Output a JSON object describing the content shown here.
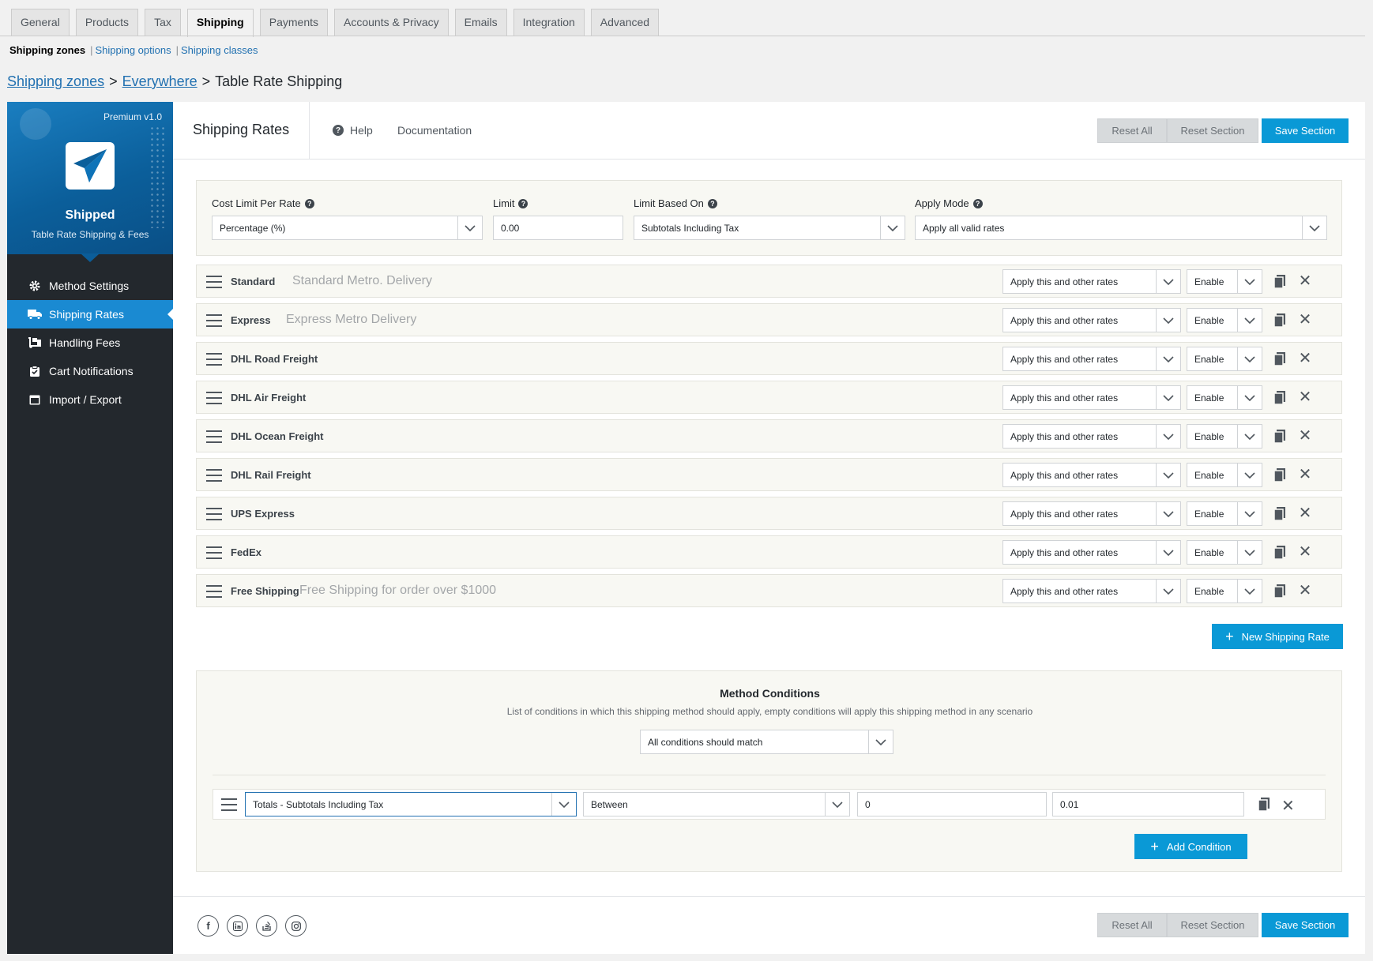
{
  "tabs": [
    "General",
    "Products",
    "Tax",
    "Shipping",
    "Payments",
    "Accounts & Privacy",
    "Emails",
    "Integration",
    "Advanced"
  ],
  "active_tab": "Shipping",
  "subnav": {
    "current": "Shipping zones",
    "links": [
      "Shipping options",
      "Shipping classes"
    ],
    "separator": "|"
  },
  "breadcrumb": {
    "links": [
      "Shipping zones",
      "Everywhere"
    ],
    "current": "Table Rate Shipping",
    "separator": ">"
  },
  "brand": {
    "version": "Premium v1.0",
    "name": "Shipped",
    "tagline": "Table Rate Shipping & Fees"
  },
  "menu": [
    {
      "label": "Method Settings",
      "icon": "gear-icon"
    },
    {
      "label": "Shipping Rates",
      "icon": "truck-icon"
    },
    {
      "label": "Handling Fees",
      "icon": "dolly-icon"
    },
    {
      "label": "Cart Notifications",
      "icon": "clipboard-icon"
    },
    {
      "label": "Import / Export",
      "icon": "window-icon"
    }
  ],
  "active_menu": "Shipping Rates",
  "header": {
    "title": "Shipping Rates",
    "help": "Help",
    "documentation": "Documentation",
    "reset_all": "Reset All",
    "reset_section": "Reset Section",
    "save_section": "Save Section"
  },
  "config": {
    "cost_limit_label": "Cost Limit Per Rate",
    "cost_limit_value": "Percentage (%)",
    "limit_label": "Limit",
    "limit_value": "0.00",
    "limit_based_label": "Limit Based On",
    "limit_based_value": "Subtotals Including Tax",
    "apply_mode_label": "Apply Mode",
    "apply_mode_value": "Apply all valid rates"
  },
  "rates": [
    {
      "name": "Standard",
      "desc": "Standard Metro. Delivery",
      "mode": "Apply this and other rates",
      "status": "Enable"
    },
    {
      "name": "Express",
      "desc": "Express Metro Delivery",
      "mode": "Apply this and other rates",
      "status": "Enable"
    },
    {
      "name": "DHL Road Freight",
      "desc": "",
      "mode": "Apply this and other rates",
      "status": "Enable"
    },
    {
      "name": "DHL Air Freight",
      "desc": "",
      "mode": "Apply this and other rates",
      "status": "Enable"
    },
    {
      "name": "DHL Ocean Freight",
      "desc": "",
      "mode": "Apply this and other rates",
      "status": "Enable"
    },
    {
      "name": "DHL Rail Freight",
      "desc": "",
      "mode": "Apply this and other rates",
      "status": "Enable"
    },
    {
      "name": "UPS Express",
      "desc": "",
      "mode": "Apply this and other rates",
      "status": "Enable"
    },
    {
      "name": "FedEx",
      "desc": "",
      "mode": "Apply this and other rates",
      "status": "Enable"
    },
    {
      "name": "Free Shipping",
      "desc": "Free Shipping for order over $1000",
      "mode": "Apply this and other rates",
      "status": "Enable"
    }
  ],
  "new_rate_button": "New Shipping Rate",
  "conditions": {
    "title": "Method Conditions",
    "subtitle": "List of conditions in which this shipping method should apply, empty conditions will apply this shipping method in any scenario",
    "match_value": "All conditions should match",
    "row": {
      "field": "Totals - Subtotals Including Tax",
      "operator": "Between",
      "min": "0",
      "max": "0.01"
    },
    "add_button": "Add Condition"
  },
  "social_icons": [
    "facebook-icon",
    "linkedin-icon",
    "stackoverflow-icon",
    "instagram-icon"
  ],
  "colors": {
    "accent": "#0a99d6",
    "sidebar": "#23282d",
    "brand_blue": "#0b5f9b",
    "active_menu": "#1a8ad2"
  }
}
